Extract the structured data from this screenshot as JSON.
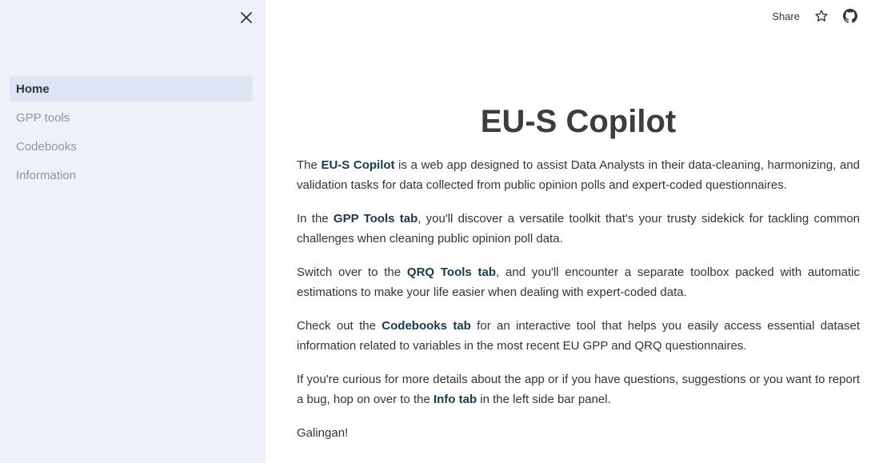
{
  "sidebar": {
    "items": [
      {
        "label": "Home",
        "active": true
      },
      {
        "label": "GPP tools",
        "active": false
      },
      {
        "label": "Codebooks",
        "active": false
      },
      {
        "label": "Information",
        "active": false
      }
    ],
    "close_icon": "close-icon"
  },
  "topbar": {
    "share_label": "Share",
    "star_icon": "star-icon",
    "github_icon": "github-icon"
  },
  "main": {
    "title": "EU-S Copilot",
    "paragraphs": [
      {
        "p1_pre": "The ",
        "p1_hl": "EU-S Copilot",
        "p1_post": " is a web app designed to assist Data Analysts in their data-cleaning, harmonizing, and validation tasks for data collected from public opinion polls and expert-coded questionnaires."
      },
      {
        "p2_pre": "In the ",
        "p2_hl": "GPP Tools tab",
        "p2_post": ", you'll discover a versatile toolkit that's your trusty sidekick for tackling common challenges when cleaning public opinion poll data."
      },
      {
        "p3_pre": "Switch over to the ",
        "p3_hl": "QRQ Tools tab",
        "p3_post": ", and you'll encounter a separate toolbox packed with automatic estimations to make your life easier when dealing with expert-coded data."
      },
      {
        "p4_pre": "Check out the ",
        "p4_hl": "Codebooks tab",
        "p4_post": " for an interactive tool that helps you easily access essential dataset information related to variables in the most recent EU GPP and QRQ questionnaires."
      },
      {
        "p5_pre": "If you're curious for more details about the app or if you have questions, suggestions or you want to report a bug, hop on over to the ",
        "p5_hl": "Info tab",
        "p5_post": " in the left side bar panel."
      },
      {
        "p6": "Galingan!"
      }
    ]
  },
  "colors": {
    "sidebar_bg": "#eef1f8",
    "active_item_bg": "#dde4f3",
    "text": "#31333f",
    "muted_text": "#8e94a0",
    "highlight": "#1a3a4a"
  }
}
